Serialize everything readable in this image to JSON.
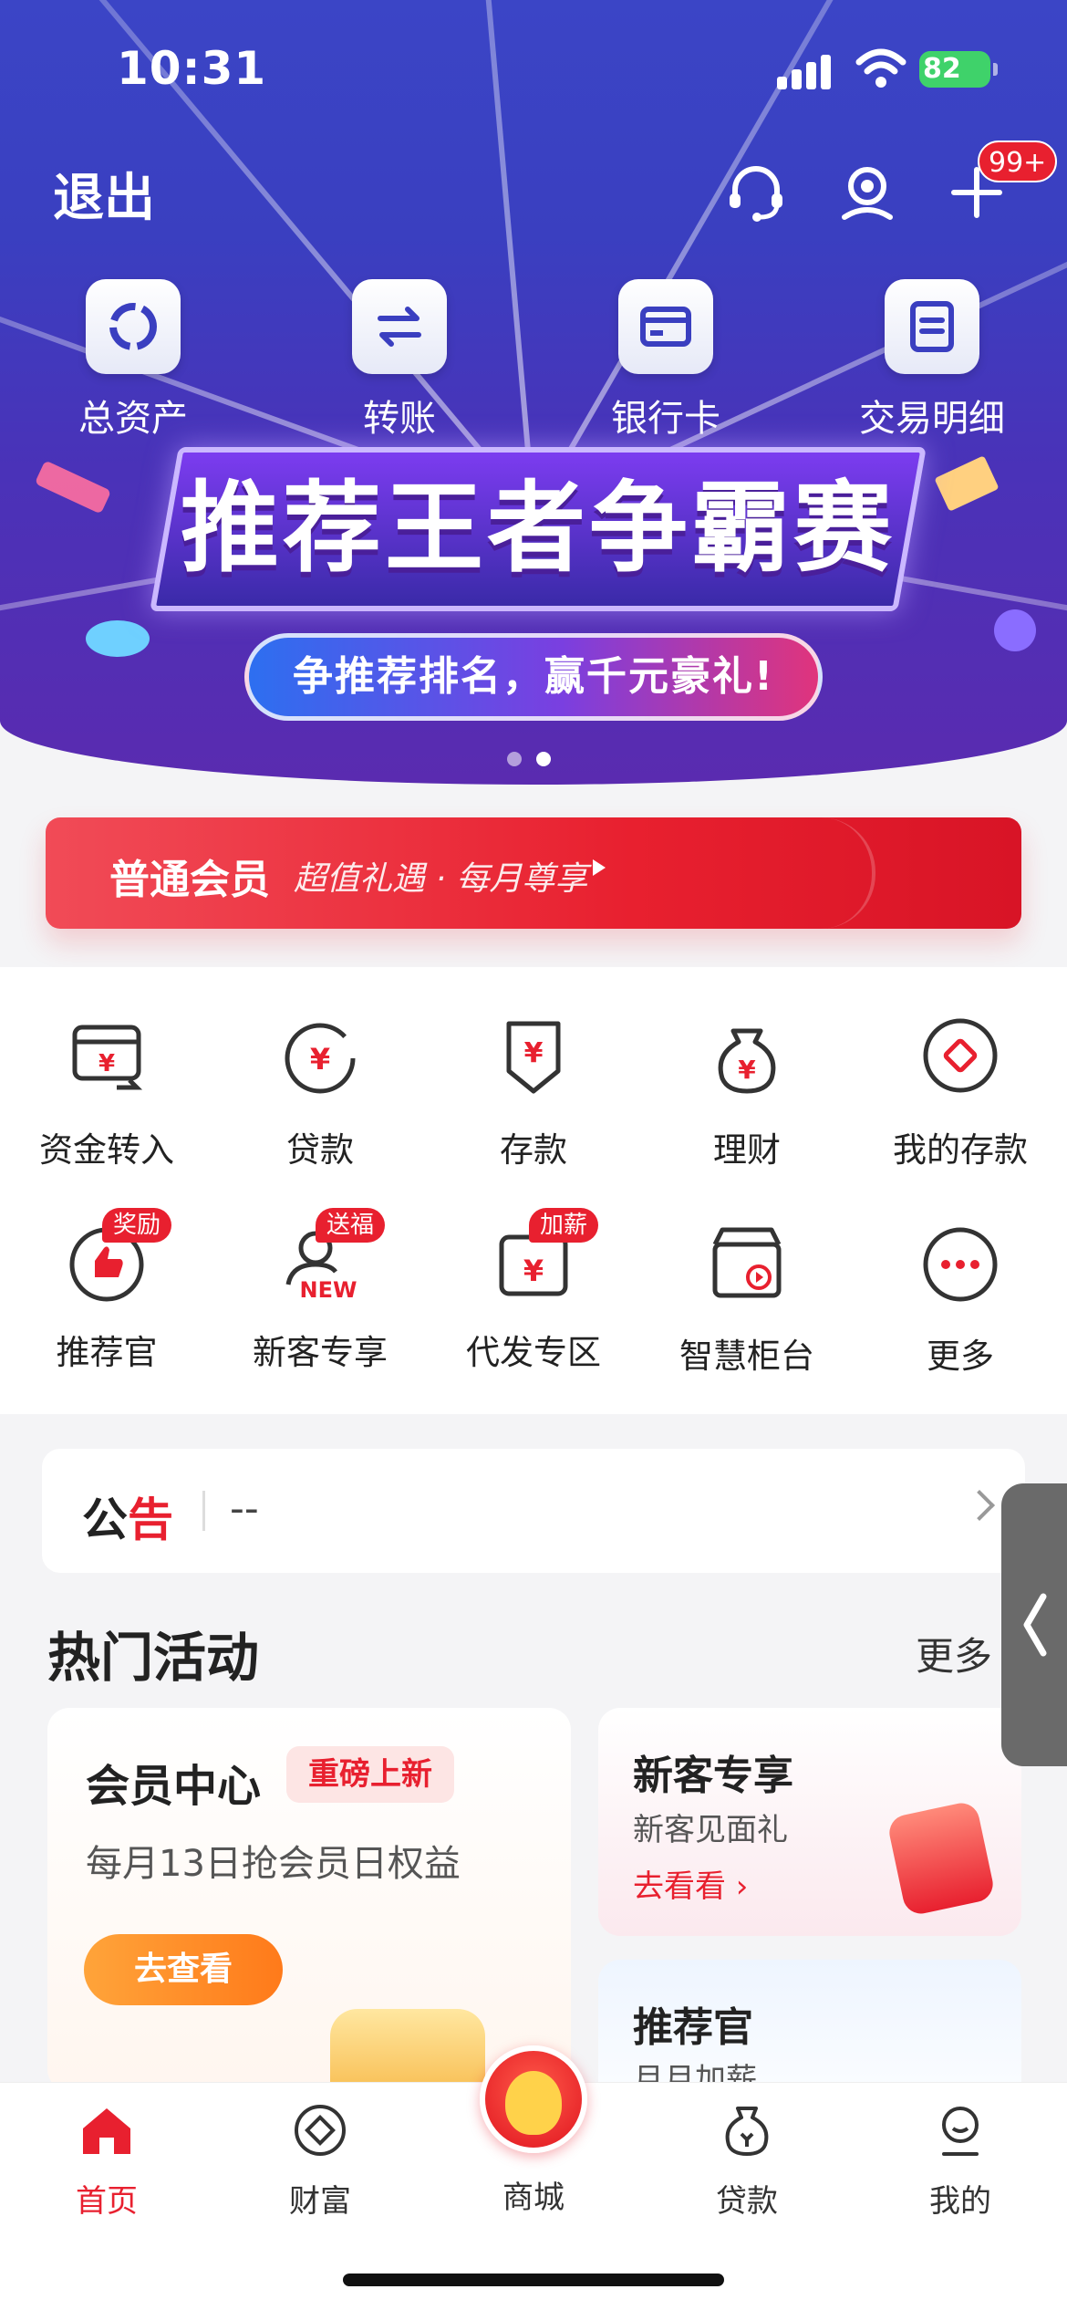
{
  "status": {
    "time": "10:31",
    "battery": "82"
  },
  "header": {
    "exit_label": "退出",
    "badge": "99+"
  },
  "quick_actions": [
    {
      "label": "总资产",
      "icon": "total-assets-icon"
    },
    {
      "label": "转账",
      "icon": "transfer-icon"
    },
    {
      "label": "银行卡",
      "icon": "bank-card-icon"
    },
    {
      "label": "交易明细",
      "icon": "transaction-details-icon"
    }
  ],
  "banner": {
    "title": "推荐王者争霸赛",
    "subtitle": "争推荐排名，赢千元豪礼!",
    "active_slide": 2,
    "slide_count": 2
  },
  "member": {
    "title": "普通会员",
    "subtitle": "超值礼遇 · 每月尊享"
  },
  "services": [
    {
      "label": "资金转入",
      "icon": "fund-transfer-in-icon"
    },
    {
      "label": "贷款",
      "icon": "loan-icon"
    },
    {
      "label": "存款",
      "icon": "deposit-icon"
    },
    {
      "label": "理财",
      "icon": "wealth-icon"
    },
    {
      "label": "我的存款",
      "icon": "my-deposit-icon"
    },
    {
      "label": "推荐官",
      "icon": "referrer-icon",
      "tag": "奖励"
    },
    {
      "label": "新客专享",
      "icon": "new-customer-icon",
      "tag": "送福"
    },
    {
      "label": "代发专区",
      "icon": "payroll-icon",
      "tag": "加薪"
    },
    {
      "label": "智慧柜台",
      "icon": "smart-counter-icon"
    },
    {
      "label": "更多",
      "icon": "more-icon"
    }
  ],
  "notice": {
    "label_1": "公",
    "label_2": "告",
    "text": "--"
  },
  "hot": {
    "title": "热门活动",
    "more": "更多",
    "member_center": {
      "title": "会员中心",
      "tag": "重磅上新",
      "desc": "每月13日抢会员日权益",
      "button": "去查看"
    },
    "new_customer": {
      "title": "新客专享",
      "desc": "新客见面礼",
      "link": "去看看"
    },
    "referrer": {
      "title": "推荐官",
      "desc": "月月加薪"
    }
  },
  "tabbar": [
    {
      "label": "首页",
      "active": true
    },
    {
      "label": "财富",
      "active": false
    },
    {
      "label": "商城",
      "active": false
    },
    {
      "label": "贷款",
      "active": false
    },
    {
      "label": "我的",
      "active": false
    }
  ],
  "colors": {
    "brand_red": "#e8202f",
    "hero_blue": "#3b45c6",
    "accent_orange": "#ff7a1a"
  }
}
